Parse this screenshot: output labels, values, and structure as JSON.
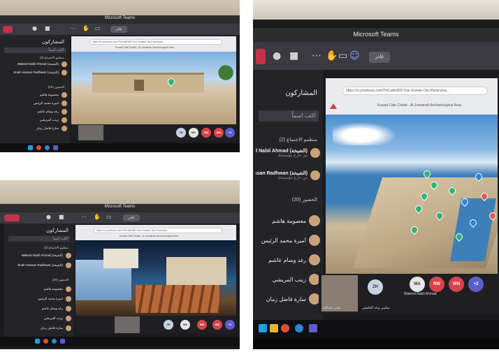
{
  "app": {
    "title": "Microsoft Teams"
  },
  "panel": {
    "title": "المشاركون",
    "search_placeholder": "اكتب اسماً",
    "group_organizers": "منظمو الاجتماع (2)",
    "group_attendees": "الحضور (20)",
    "organizers": [
      {
        "name": "Waleed Nabil Ahmad (الشيخة)",
        "sub": "من خارج مؤسستك"
      },
      {
        "name": "Jinab Hassan Radhwan (الشيخة)",
        "sub": "من خارج مؤسستك"
      }
    ],
    "attendees": [
      {
        "name": "معصومة هاشم"
      },
      {
        "name": "أميرة محمد الرئيس"
      },
      {
        "name": "رغد وسام عاشم"
      },
      {
        "name": "زينب المريشي"
      },
      {
        "name": "سارة فاضل زمان"
      }
    ]
  },
  "toolbar": {
    "share_label": "غادر"
  },
  "browser": {
    "url": "https://vr.yourtours.com/ThiCafe/360-Tour-Kuwait-City-Panorama...",
    "page_title": "Kuwait Cafe Chalet - Al Jumainah Archaeological Area"
  },
  "call": {
    "initials": [
      "ZH",
      "MA",
      "RW",
      "WN",
      "+2"
    ],
    "video_names": [
      "غدير عبدالله",
      "Waleed Nabil Ahmad",
      "سلمى وعد الخليفي"
    ]
  },
  "colors": {
    "teams_bar": "#2b2b30",
    "leave_red": "#c4314b",
    "panel_bg": "#242428",
    "sky": "#5e9fd4",
    "sea": "#3d7fb8"
  },
  "icons": [
    "leave-icon",
    "mic-icon",
    "camera-icon",
    "more-icon",
    "hand-icon",
    "chat-icon",
    "participants-icon",
    "windows-icon",
    "chrome-icon",
    "edge-icon",
    "teams-icon",
    "map-pin-icon"
  ]
}
